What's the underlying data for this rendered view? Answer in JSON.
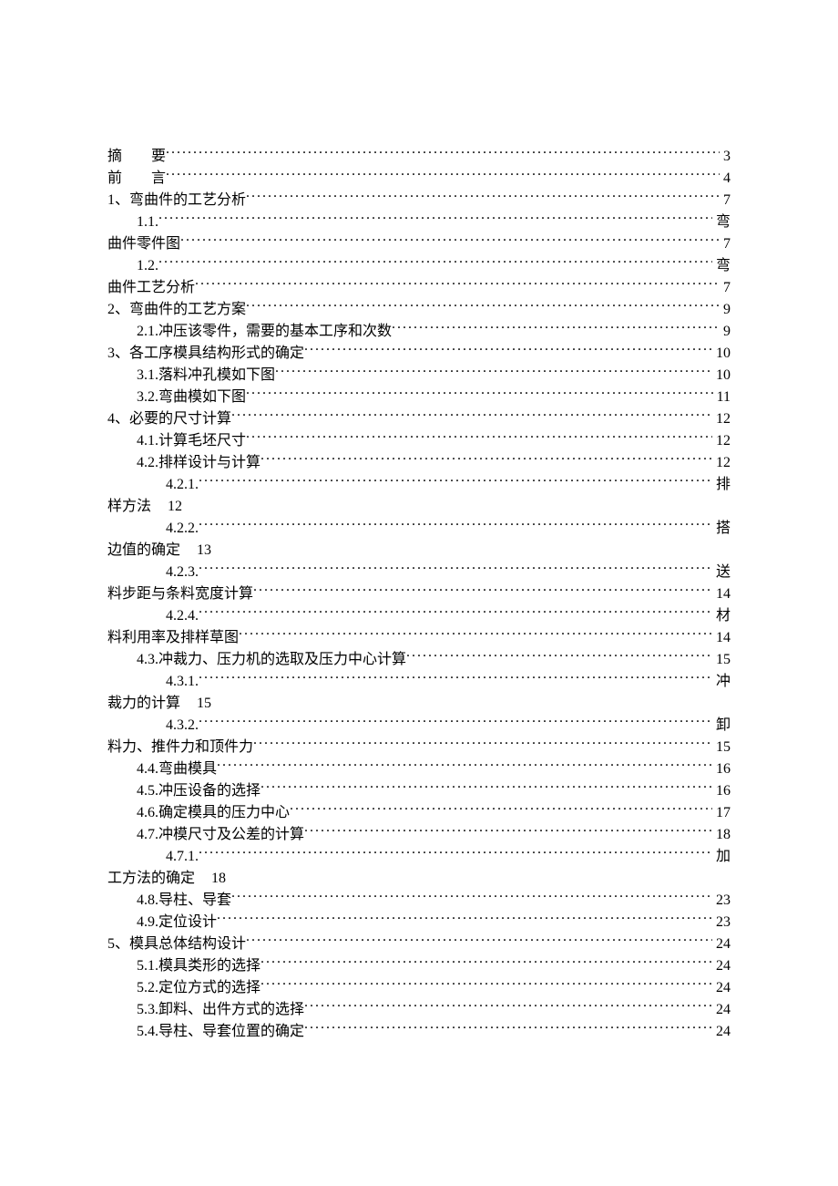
{
  "toc": [
    {
      "type": "row",
      "indent": 0,
      "label": "摘　　要",
      "page": "3",
      "spaced": false
    },
    {
      "type": "row",
      "indent": 0,
      "label": "前　　言",
      "page": "4",
      "spaced": false
    },
    {
      "type": "row",
      "indent": 0,
      "label": "1、弯曲件的工艺分析",
      "page": "7"
    },
    {
      "type": "row",
      "indent": 1,
      "label": "1.1.",
      "page": "弯"
    },
    {
      "type": "cont",
      "indent": 0,
      "label": "曲件零件图",
      "page": "7"
    },
    {
      "type": "row",
      "indent": 1,
      "label": "1.2.",
      "page": "弯"
    },
    {
      "type": "cont",
      "indent": 0,
      "label": "曲件工艺分析",
      "page": "7"
    },
    {
      "type": "row",
      "indent": 0,
      "label": "2、弯曲件的工艺方案",
      "page": "9"
    },
    {
      "type": "row",
      "indent": 1,
      "label": "2.1.冲压该零件，需要的基本工序和次数",
      "page": "9"
    },
    {
      "type": "row",
      "indent": 0,
      "label": "3、各工序模具结构形式的确定",
      "page": "10"
    },
    {
      "type": "row",
      "indent": 1,
      "label": "3.1.落料冲孔模如下图",
      "page": "10"
    },
    {
      "type": "row",
      "indent": 1,
      "label": "3.2.弯曲模如下图",
      "page": "11"
    },
    {
      "type": "row",
      "indent": 0,
      "label": "4、必要的尺寸计算",
      "page": "12"
    },
    {
      "type": "row",
      "indent": 1,
      "label": "4.1.计算毛坯尺寸",
      "page": "12"
    },
    {
      "type": "row",
      "indent": 1,
      "label": "4.2.排样设计与计算",
      "page": "12"
    },
    {
      "type": "row",
      "indent": 2,
      "label": "4.2.1.",
      "page": "排"
    },
    {
      "type": "cont2",
      "indent": 0,
      "label": "样方法",
      "page": "12"
    },
    {
      "type": "row",
      "indent": 2,
      "label": "4.2.2.",
      "page": "搭"
    },
    {
      "type": "cont2",
      "indent": 0,
      "label": "边值的确定",
      "page": "13"
    },
    {
      "type": "row",
      "indent": 2,
      "label": "4.2.3.",
      "page": "送"
    },
    {
      "type": "cont",
      "indent": 0,
      "label": "料步距与条料宽度计算",
      "page": "14"
    },
    {
      "type": "row",
      "indent": 2,
      "label": "4.2.4.",
      "page": "材"
    },
    {
      "type": "cont",
      "indent": 0,
      "label": "料利用率及排样草图",
      "page": "14"
    },
    {
      "type": "row",
      "indent": 1,
      "label": "4.3.冲裁力、压力机的选取及压力中心计算",
      "page": "15"
    },
    {
      "type": "row",
      "indent": 2,
      "label": "4.3.1.",
      "page": "冲"
    },
    {
      "type": "cont2",
      "indent": 0,
      "label": "裁力的计算",
      "page": "15"
    },
    {
      "type": "row",
      "indent": 2,
      "label": "4.3.2.",
      "page": "卸"
    },
    {
      "type": "cont",
      "indent": 0,
      "label": "料力、推件力和顶件力",
      "page": "15"
    },
    {
      "type": "row",
      "indent": 1,
      "label": "4.4.弯曲模具",
      "page": "16"
    },
    {
      "type": "row",
      "indent": 1,
      "label": "4.5.冲压设备的选择",
      "page": "16"
    },
    {
      "type": "row",
      "indent": 1,
      "label": "4.6.确定模具的压力中心",
      "page": "17"
    },
    {
      "type": "row",
      "indent": 1,
      "label": "4.7.冲模尺寸及公差的计算",
      "page": "18"
    },
    {
      "type": "row",
      "indent": 2,
      "label": "4.7.1.",
      "page": "加"
    },
    {
      "type": "cont2",
      "indent": 0,
      "label": "工方法的确定",
      "page": "18"
    },
    {
      "type": "row",
      "indent": 1,
      "label": "4.8.导柱、导套",
      "page": "23"
    },
    {
      "type": "row",
      "indent": 1,
      "label": "4.9.定位设计",
      "page": "23"
    },
    {
      "type": "row",
      "indent": 0,
      "label": "5、模具总体结构设计",
      "page": "24"
    },
    {
      "type": "row",
      "indent": 1,
      "label": "5.1.模具类形的选择",
      "page": "24"
    },
    {
      "type": "row",
      "indent": 1,
      "label": "5.2.定位方式的选择",
      "page": "24"
    },
    {
      "type": "row",
      "indent": 1,
      "label": "5.3.卸料、出件方式的选择",
      "page": "24"
    },
    {
      "type": "row",
      "indent": 1,
      "label": "5.4.导柱、导套位置的确定",
      "page": "24"
    }
  ]
}
